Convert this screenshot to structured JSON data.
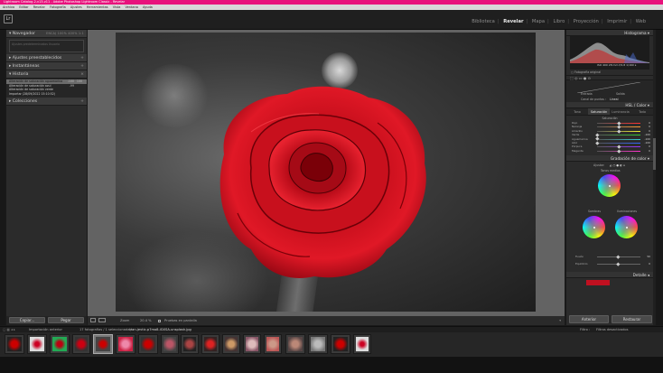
{
  "window": {
    "title": "Lightroom Catalog-2-v13-v11 - Adobe Photoshop Lightroom Classic - Revelar"
  },
  "menu": [
    "Archivo",
    "Editar",
    "Revelar",
    "Fotografía",
    "Ajustes",
    "Herramientas",
    "Vista",
    "Ventana",
    "Ayuda"
  ],
  "logo": "Lr",
  "modules": [
    "Biblioteca",
    "Revelar",
    "Mapa",
    "Libro",
    "Proyección",
    "Imprimir",
    "Web"
  ],
  "active_module": "Revelar",
  "left": {
    "navigator": {
      "title": "Navegador",
      "zoom_opts": "ENCAJ  100%  400%  1:1"
    },
    "navbox_text": "Ajustes predeterminados  Usuario",
    "presets": "Ajustes preestablecidos",
    "snapshots": "Instantáneas",
    "history": "Historia",
    "history_items": [
      {
        "label": "Alteración de saturación aguamarina",
        "v1": "-100",
        "v2": "100"
      },
      {
        "label": "Alteración de saturación azul",
        "v1": "-99",
        "v2": ""
      },
      {
        "label": "Alteración de saturación verde",
        "v1": "",
        "v2": ""
      },
      {
        "label": "Importar (28/09/2022 15:10:52)",
        "v1": "",
        "v2": ""
      }
    ],
    "collections": "Colecciones",
    "copy": "Copiar...",
    "paste": "Pegar"
  },
  "toolbar": {
    "label1": "Zoom",
    "label2": "20.4 %",
    "proof": "Pruebas en pantalla"
  },
  "right": {
    "histogram": "Histograma",
    "hist_info": "ISO 400   28 mm   f/2,8   1/160 s",
    "original": "Fotografía original",
    "curve_entry": "Entrada",
    "curve_exit": "Salida",
    "curve_channel": "Canal de puntos :",
    "curve_value": "Lineal",
    "hsl_title": "HSL / Color",
    "hsl_tabs": [
      "Tono",
      "Saturación",
      "Luminancia",
      "Todo"
    ],
    "hsl_section": "Saturación",
    "hsl_rows": [
      {
        "label": "Rojo",
        "value": "0"
      },
      {
        "label": "Naranja",
        "value": "0"
      },
      {
        "label": "Amarillo",
        "value": "0"
      },
      {
        "label": "Verde",
        "value": "-100"
      },
      {
        "label": "Aguamarina",
        "value": "-100"
      },
      {
        "label": "Azul",
        "value": "-100"
      },
      {
        "label": "Púrpura",
        "value": "0"
      },
      {
        "label": "Magenta",
        "value": "0"
      }
    ],
    "grading_title": "Gradación de color",
    "grading_adjust": "Ajustar:",
    "midtones": "Tonos medios",
    "shadows": "Sombras",
    "highlights": "Iluminaciones",
    "blend": "Fusión",
    "blend_value": "50",
    "balance": "Equilibrio",
    "balance_value": "0",
    "detail": "Detalle",
    "prev": "Anterior",
    "reset": "Restaurar"
  },
  "film": {
    "source": "Importación anterior",
    "count": "17 fotografías / 1 seleccionada /",
    "file": "ivan-jevtic-p7mo8-iGXSA-unsplash.jpg",
    "filter_label": "Filtro :",
    "filter_value": "Filtros desactivados"
  },
  "colors": {
    "accent": "#e8127c",
    "rose": "#d3101e"
  }
}
